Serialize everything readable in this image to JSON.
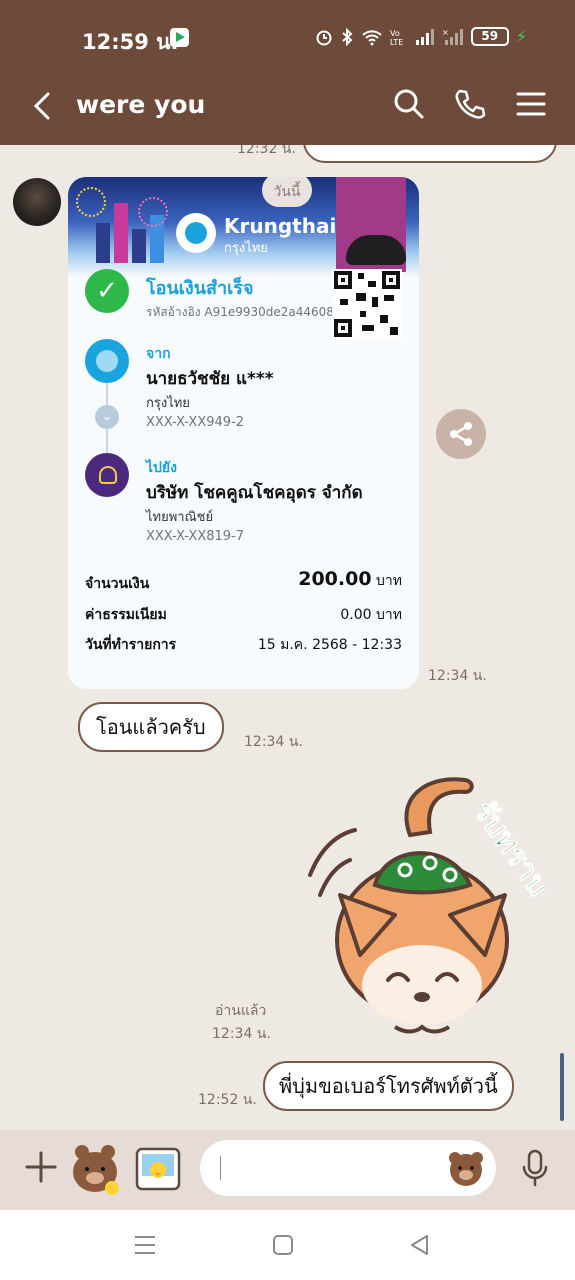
{
  "status_bar": {
    "time": "12:59 น.",
    "battery": "59",
    "icons": [
      "alarm-icon",
      "bluetooth-icon",
      "wifi-icon",
      "volte-icon",
      "signal-icon",
      "signal-icon-2",
      "battery-icon",
      "charging-icon"
    ]
  },
  "header": {
    "title": "were you",
    "icons": [
      "back-arrow-icon",
      "search-icon",
      "phone-icon",
      "menu-icon"
    ]
  },
  "messages": {
    "previous_time": "12:32 น.",
    "slip": {
      "today_label": "วันนี้",
      "bank_name": "Krungthai",
      "bank_name_thai": "กรุงไทย",
      "success_title": "โอนเงินสำเร็จ",
      "reference": "รหัสอ้างอิง A91e9930de2a44608",
      "from_label": "จาก",
      "from_name": "นายธวัชชัย แ***",
      "from_bank": "กรุงไทย",
      "from_account": "XXX-X-XX949-2",
      "to_label": "ไปยัง",
      "to_name": "บริษัท โชคคูณโชคอุดร จำกัด",
      "to_bank": "ไทยพาณิชย์",
      "to_account": "XXX-X-XX819-7",
      "amount_label": "จำนวนเงิน",
      "amount_value": "200.00",
      "amount_unit": "บาท",
      "fee_label": "ค่าธรรมเนียม",
      "fee_value": "0.00 บาท",
      "date_label": "วันที่ทำรายการ",
      "date_value": "15 ม.ค. 2568 - 12:33"
    },
    "slip_time": "12:34 น.",
    "text_message": "โอนแล้วครับ",
    "text_time": "12:34 น.",
    "sticker_text": "รับทราบ",
    "read_label": "อ่านแล้ว",
    "read_time": "12:34 น.",
    "outgoing_message": "พี่บุ่มขอเบอร์โทรศัพท์ตัวนี้",
    "outgoing_time": "12:52 น."
  },
  "input_bar": {
    "placeholder": "",
    "icons": [
      "plus-icon",
      "sticker-icon",
      "photo-icon",
      "emoji-icon",
      "microphone-icon"
    ]
  },
  "nav_bar": {
    "icons": [
      "recent-apps-icon",
      "home-icon",
      "back-icon"
    ]
  },
  "colors": {
    "header": "#6d4a3a",
    "chat_background": "#efe9e4",
    "bubble_border": "#7a5a4a",
    "krungthai_blue": "#1aa0da",
    "success_green": "#2fb84a"
  }
}
